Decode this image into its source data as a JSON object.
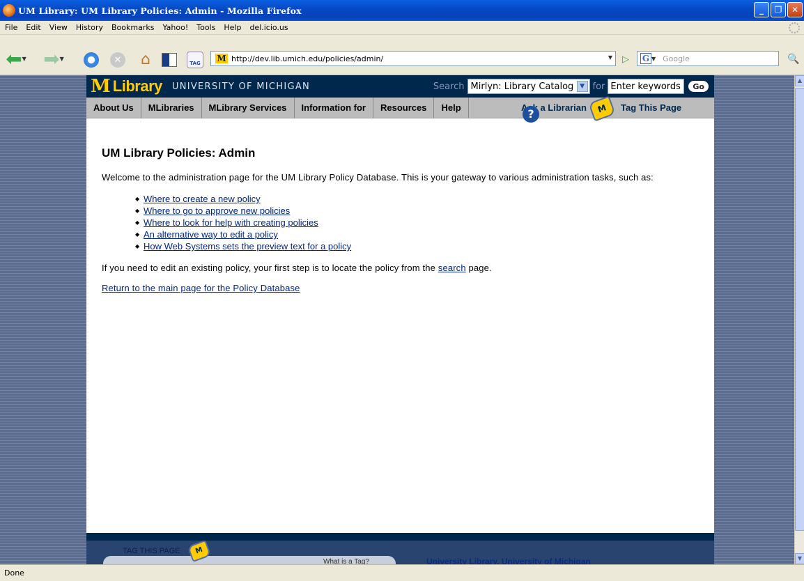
{
  "window": {
    "title": "UM Library: UM Library Policies: Admin - Mozilla Firefox"
  },
  "menu": [
    "File",
    "Edit",
    "View",
    "History",
    "Bookmarks",
    "Yahoo!",
    "Tools",
    "Help",
    "del.icio.us"
  ],
  "toolbar": {
    "tag_label": "TAG",
    "url": "http://dev.lib.umich.edu/policies/admin/",
    "search_engine_glyph": "G",
    "search_placeholder": "Google"
  },
  "site": {
    "logo_m": "M",
    "logo_library": "Library",
    "university": "UNIVERSITY OF MICHIGAN",
    "search_label": "Search",
    "catalog_select": "Mirlyn: Library Catalog",
    "for_label": "for",
    "keywords_value": "Enter keywords",
    "go_label": "Go",
    "nav": [
      "About Us",
      "MLibraries",
      "MLibrary Services",
      "Information for",
      "Resources",
      "Help"
    ],
    "ask_librarian": "Ask a Librarian",
    "tag_page": "Tag This Page"
  },
  "content": {
    "heading": "UM Library Policies: Admin",
    "intro": "Welcome to the administration page for the UM Library Policy Database. This is your gateway to various administration tasks, such as:",
    "links": [
      "Where to create a new policy",
      "Where to go to approve new policies",
      "Where to look for help with creating policies",
      "An alternative way to edit a policy",
      "How Web Systems sets the preview text for a policy"
    ],
    "edit_prefix": "If you need to edit an existing policy, your first step is to locate the policy from the ",
    "edit_link": "search",
    "edit_suffix": " page.",
    "return_link": "Return to the main page for the Policy Database"
  },
  "footer": {
    "tag_this_page": "TAG THIS PAGE",
    "what_is_tag": "What is a Tag?",
    "univ_library": "University Library, University of Michigan"
  },
  "status": "Done",
  "colors": {
    "um_blue": "#00274c",
    "um_maize": "#ffcb05",
    "nav_gray": "#bcbcbc",
    "link": "#00268a"
  }
}
